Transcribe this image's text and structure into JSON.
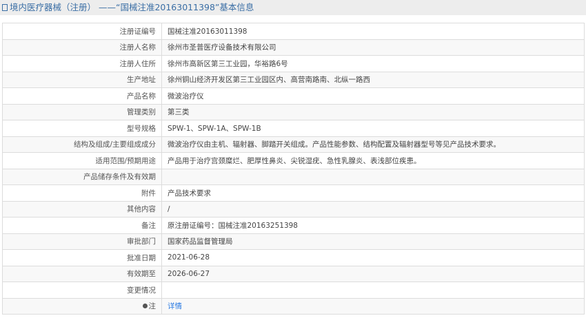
{
  "header": {
    "title": "境内医疗器械（注册） ——“国械注准20163011398”基本信息",
    "icon": "document-icon"
  },
  "rows": [
    {
      "label": "注册证编号",
      "value": "国械注准20163011398"
    },
    {
      "label": "注册人名称",
      "value": "徐州市圣普医疗设备技术有限公司"
    },
    {
      "label": "注册人住所",
      "value": "徐州市高新区第三工业园，华裕路6号"
    },
    {
      "label": "生产地址",
      "value": "徐州铜山经济开发区第三工业园区内、高营南路南、北纵一路西"
    },
    {
      "label": "产品名称",
      "value": "微波治疗仪"
    },
    {
      "label": "管理类别",
      "value": "第三类"
    },
    {
      "label": "型号规格",
      "value": "SPW-1、SPW-1A、SPW-1B"
    },
    {
      "label": "结构及组成/主要组成成分",
      "value": "微波治疗仪由主机、辐射器、脚踏开关组成。产品性能参数、结构配置及辐射器型号等见产品技术要求。"
    },
    {
      "label": "适用范围/预期用途",
      "value": "产品用于治疗宫颈糜烂、肥厚性鼻炎、尖锐湿疣、急性乳腺炎、表浅部位疾患。"
    },
    {
      "label": "产品储存条件及有效期",
      "value": ""
    },
    {
      "label": "附件",
      "value": "产品技术要求"
    },
    {
      "label": "其他内容",
      "value": "/"
    },
    {
      "label": "备注",
      "value": "原注册证编号：国械注准20163251398"
    },
    {
      "label": "审批部门",
      "value": "国家药品监督管理局"
    },
    {
      "label": "批准日期",
      "value": "2021-06-28"
    },
    {
      "label": "有效期至",
      "value": "2026-06-27"
    },
    {
      "label": "变更情况",
      "value": ""
    }
  ],
  "note": {
    "label": "注",
    "link": "详情"
  }
}
